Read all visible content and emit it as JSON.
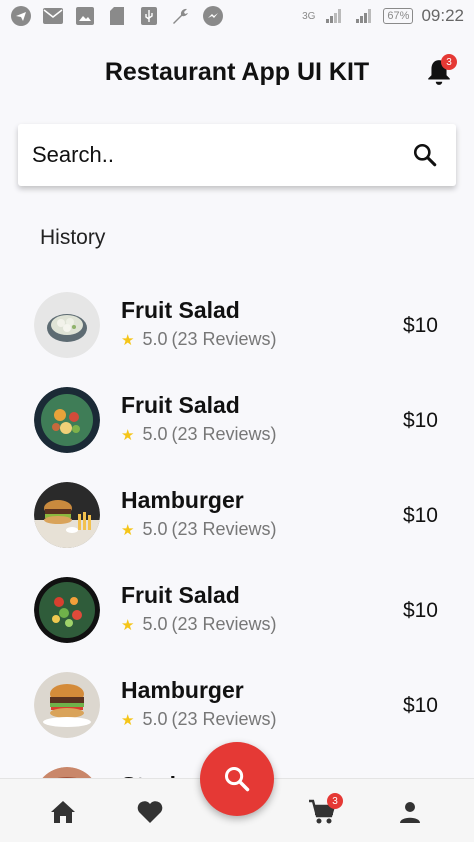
{
  "status_bar": {
    "network": "3G",
    "battery": "67%",
    "time": "09:22"
  },
  "header": {
    "title": "Restaurant App UI KIT",
    "notification_count": "3"
  },
  "search": {
    "placeholder": "Search.."
  },
  "section": {
    "title": "History"
  },
  "items": [
    {
      "name": "Fruit Salad",
      "rating": "5.0",
      "reviews": "(23 Reviews)",
      "price": "$10"
    },
    {
      "name": "Fruit Salad",
      "rating": "5.0",
      "reviews": "(23 Reviews)",
      "price": "$10"
    },
    {
      "name": "Hamburger",
      "rating": "5.0",
      "reviews": "(23 Reviews)",
      "price": "$10"
    },
    {
      "name": "Fruit Salad",
      "rating": "5.0",
      "reviews": "(23 Reviews)",
      "price": "$10"
    },
    {
      "name": "Hamburger",
      "rating": "5.0",
      "reviews": "(23 Reviews)",
      "price": "$10"
    }
  ],
  "partial_item": {
    "name": "Steak"
  },
  "bottom_nav": {
    "cart_count": "3"
  },
  "colors": {
    "accent": "#e53935",
    "star": "#f5c518"
  }
}
